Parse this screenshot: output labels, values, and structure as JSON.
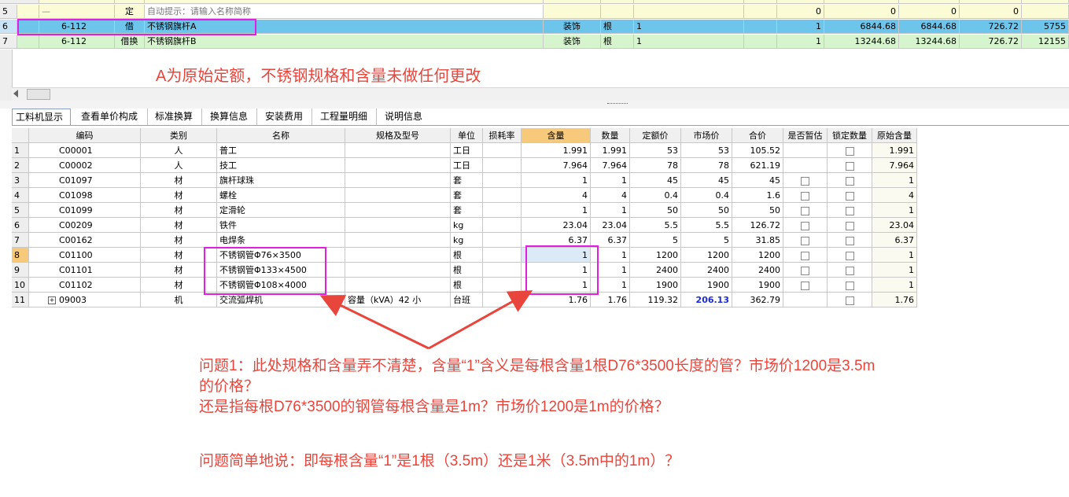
{
  "top_rows": [
    {
      "row": "5",
      "code": "",
      "type": "定",
      "name": "自动提示：请输入名称简称",
      "unit_cat": "",
      "unit": "",
      "qty": "",
      "v1": "0",
      "v2": "0",
      "v3": "0",
      "v4": "0"
    },
    {
      "row": "6",
      "code": "6-112",
      "type": "借",
      "name": "不锈钢旗杆A",
      "unit_cat": "装饰",
      "unit": "根",
      "qty": "1",
      "q2": "1",
      "v1": "6844.68",
      "v2": "6844.68",
      "v3": "726.72",
      "v4": "5755"
    },
    {
      "row": "7",
      "code": "6-112",
      "type": "借换",
      "name": "不锈钢旗杆B",
      "unit_cat": "装饰",
      "unit": "根",
      "qty": "1",
      "q2": "1",
      "v1": "13244.68",
      "v2": "13244.68",
      "v3": "726.72",
      "v4": "12155"
    }
  ],
  "annotation_top": "A为原始定额，不锈钢规格和含量未做任何更改",
  "tabs": [
    "工料机显示",
    "查看单价构成",
    "标准换算",
    "换算信息",
    "安装费用",
    "工程量明细",
    "说明信息"
  ],
  "headers": [
    "编码",
    "类别",
    "名称",
    "规格及型号",
    "单位",
    "损耗率",
    "含量",
    "数量",
    "定额价",
    "市场价",
    "合价",
    "是否暂估",
    "锁定数量",
    "原始含量"
  ],
  "rows": [
    {
      "n": "1",
      "code": "C00001",
      "cat": "人",
      "name": "普工",
      "spec": "",
      "unit": "工日",
      "loss": "",
      "qty": "1.991",
      "num": "1.991",
      "price": "53",
      "market": "53",
      "total": "105.52",
      "est": false,
      "lock": true,
      "orig": "1.991"
    },
    {
      "n": "2",
      "code": "C00002",
      "cat": "人",
      "name": "技工",
      "spec": "",
      "unit": "工日",
      "loss": "",
      "qty": "7.964",
      "num": "7.964",
      "price": "78",
      "market": "78",
      "total": "621.19",
      "est": false,
      "lock": true,
      "orig": "7.964"
    },
    {
      "n": "3",
      "code": "C01097",
      "cat": "材",
      "name": "旗杆球珠",
      "spec": "",
      "unit": "套",
      "loss": "",
      "qty": "1",
      "num": "1",
      "price": "45",
      "market": "45",
      "total": "45",
      "est": true,
      "lock": true,
      "orig": "1"
    },
    {
      "n": "4",
      "code": "C01098",
      "cat": "材",
      "name": "螺栓",
      "spec": "",
      "unit": "套",
      "loss": "",
      "qty": "4",
      "num": "4",
      "price": "0.4",
      "market": "0.4",
      "total": "1.6",
      "est": true,
      "lock": true,
      "orig": "4"
    },
    {
      "n": "5",
      "code": "C01099",
      "cat": "材",
      "name": "定滑轮",
      "spec": "",
      "unit": "套",
      "loss": "",
      "qty": "1",
      "num": "1",
      "price": "50",
      "market": "50",
      "total": "50",
      "est": true,
      "lock": true,
      "orig": "1"
    },
    {
      "n": "6",
      "code": "C00209",
      "cat": "材",
      "name": "铁件",
      "spec": "",
      "unit": "kg",
      "loss": "",
      "qty": "23.04",
      "num": "23.04",
      "price": "5.5",
      "market": "5.5",
      "total": "126.72",
      "est": true,
      "lock": true,
      "orig": "23.04"
    },
    {
      "n": "7",
      "code": "C00162",
      "cat": "材",
      "name": "电焊条",
      "spec": "",
      "unit": "kg",
      "loss": "",
      "qty": "6.37",
      "num": "6.37",
      "price": "5",
      "market": "5",
      "total": "31.85",
      "est": true,
      "lock": true,
      "orig": "6.37"
    },
    {
      "n": "8",
      "code": "C01100",
      "cat": "材",
      "name": "不锈钢管Φ76×3500",
      "spec": "",
      "unit": "根",
      "loss": "",
      "qty": "1",
      "num": "1",
      "price": "1200",
      "market": "1200",
      "total": "1200",
      "est": true,
      "lock": true,
      "orig": "1"
    },
    {
      "n": "9",
      "code": "C01101",
      "cat": "材",
      "name": "不锈钢管Φ133×4500",
      "spec": "",
      "unit": "根",
      "loss": "",
      "qty": "1",
      "num": "1",
      "price": "2400",
      "market": "2400",
      "total": "2400",
      "est": true,
      "lock": true,
      "orig": "1"
    },
    {
      "n": "10",
      "code": "C01102",
      "cat": "材",
      "name": "不锈钢管Φ108×4000",
      "spec": "",
      "unit": "根",
      "loss": "",
      "qty": "1",
      "num": "1",
      "price": "1900",
      "market": "1900",
      "total": "1900",
      "est": true,
      "lock": true,
      "orig": "1"
    },
    {
      "n": "11",
      "code": "09003",
      "cat": "机",
      "name": "交流弧焊机",
      "spec": "容量（kVA）42 小",
      "unit": "台班",
      "loss": "",
      "qty": "1.76",
      "num": "1.76",
      "price": "119.32",
      "market": "206.13",
      "total": "362.79",
      "est": false,
      "lock": true,
      "orig": "1.76"
    }
  ],
  "question1_line1": "问题1：此处规格和含量弄不清楚，含量“1”含义是每根含量1根D76*3500长度的管？市场价1200是3.5m",
  "question1_line2": "的价格？",
  "question1_line3": "还是指每根D76*3500的钢管每根含量是1m？市场价1200是1m的价格？",
  "question_summary": "问题简单地说：即每根含量“1”是1根（3.5m）还是1米（3.5m中的1m）？",
  "colors": {
    "annotation": "#e8453c",
    "highlight_box": "#e21ee0",
    "selected_row": "#6ec5ec",
    "green_row": "#d6f5cf",
    "qty_header": "#f7c97a",
    "market_bold": "#1b2bd6"
  }
}
